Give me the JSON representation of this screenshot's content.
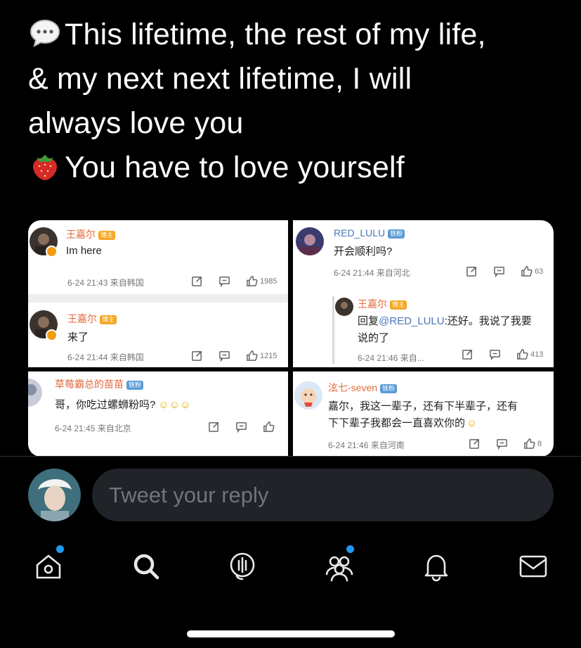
{
  "tweet": {
    "emoji1": "speech-balloon-emoji",
    "line1": "This lifetime, the rest of my life,",
    "line2": "& my next next lifetime, I will",
    "line3": "always love you",
    "emoji2": "strawberry-emoji",
    "line4": "You have to love yourself"
  },
  "media": {
    "tl": {
      "c1": {
        "user": "王嘉尔",
        "tag": "博主",
        "text": "Im here",
        "meta": "6-24 21:43 来自韩国",
        "likes": "1985"
      },
      "c2": {
        "user": "王嘉尔",
        "tag": "博主",
        "text": "来了",
        "meta": "6-24 21:44 来自韩国",
        "likes": "1215"
      }
    },
    "tr": {
      "c1": {
        "user": "RED_LULU",
        "tag": "铁粉",
        "text": "开会顺利吗?",
        "meta": "6-24 21:44 来自河北",
        "likes": "63"
      },
      "reply": {
        "user": "王嘉尔",
        "tag": "博主",
        "prefix": "回复",
        "mention": "@RED_LULU",
        "text1": ":还好。我说了我要",
        "text2": "说的了",
        "meta": "6-24 21:46 来自...",
        "likes": "413"
      }
    },
    "bl": {
      "user": "草莓霸总的苗苗",
      "tag": "铁粉",
      "text": "哥，你吃过螺蛳粉吗?",
      "meta": "6-24 21:45 来自北京"
    },
    "br": {
      "user": "泫七-seven",
      "tag": "铁粉",
      "text1": "嘉尔，我这一辈子，还有下半辈子，还有",
      "text2": "下下辈子我都会一直喜欢你的",
      "meta": "6-24 21:46 来自河南",
      "likes": "8"
    }
  },
  "reply": {
    "placeholder": "Tweet your reply"
  },
  "colors": {
    "accent": "#1d9bf0",
    "background": "#000000",
    "weibo_name": "#e4693c",
    "weibo_link": "#4a76b8"
  },
  "nav": {
    "items": [
      "home-icon",
      "search-icon",
      "spaces-icon",
      "communities-icon",
      "notifications-icon",
      "messages-icon"
    ],
    "badges": [
      "home",
      "communities"
    ]
  }
}
